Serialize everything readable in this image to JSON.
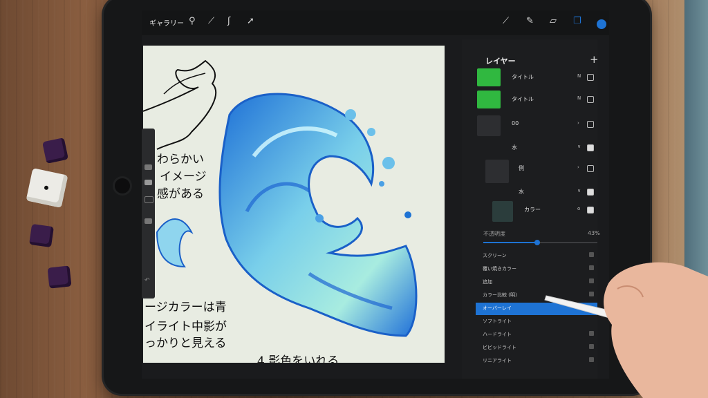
{
  "toolbar": {
    "gallery_label": "ギャラリー",
    "icons": [
      "wrench-icon",
      "magic-icon",
      "selection-icon",
      "transform-icon",
      "brush-icon",
      "smudge-icon",
      "eraser-icon",
      "layers-icon",
      "color-icon"
    ],
    "color": "#1e73d4"
  },
  "canvas": {
    "notes": [
      "わらかい",
      "イメージ",
      "感がある",
      "ージカラーは青",
      "イライト中影が",
      "っかりと見える",
      "4.影色をいれる"
    ]
  },
  "layers_panel": {
    "title": "レイヤー",
    "layers": [
      {
        "name": "タイトル",
        "mode": "N",
        "visible": false
      },
      {
        "name": "タイトル",
        "mode": "N",
        "visible": false
      },
      {
        "name": "00",
        "mode": "›",
        "visible": false
      },
      {
        "name": "水",
        "mode": "∨",
        "visible": true
      },
      {
        "name": "例",
        "mode": "›",
        "visible": false
      },
      {
        "name": "水",
        "mode": "∨",
        "visible": true
      },
      {
        "name": "カラー",
        "mode": "o",
        "visible": true
      }
    ],
    "opacity_label": "不透明度",
    "opacity_value": "43%",
    "opacity_fraction": 0.43,
    "blend_modes": [
      "スクリーン",
      "覆い焼きカラー",
      "追加",
      "カラー比較 (明)",
      "オーバーレイ",
      "ソフトライト",
      "ハードライト",
      "ビビッドライト",
      "リニアライト"
    ],
    "selected_blend_mode": "オーバーレイ"
  }
}
